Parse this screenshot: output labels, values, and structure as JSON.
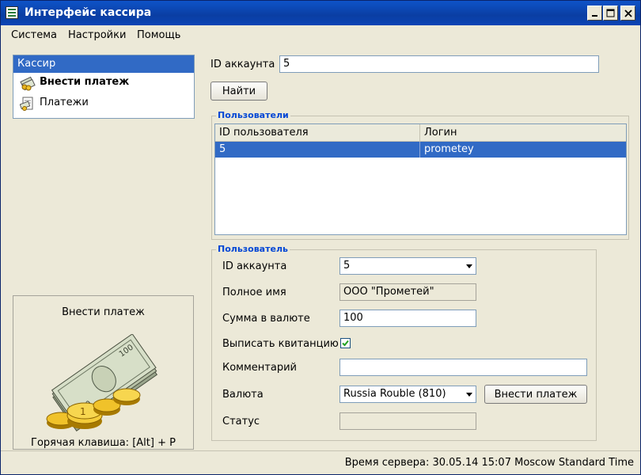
{
  "window": {
    "title": "Интерфейс кассира"
  },
  "menu": [
    "Система",
    "Настройки",
    "Помощь"
  ],
  "sidebar": {
    "header": "Кассир",
    "items": [
      {
        "label": "Внести платеж",
        "active": true,
        "icon": "payment-icon"
      },
      {
        "label": "Платежи",
        "active": false,
        "icon": "payments-list-icon"
      }
    ]
  },
  "hint": {
    "title": "Внести платеж",
    "hotkey": "Горячая клавиша: [Alt] + P"
  },
  "search": {
    "label": "ID аккаунта",
    "value": "5",
    "button": "Найти"
  },
  "users_group": {
    "title": "Пользователи",
    "columns": [
      "ID пользователя",
      "Логин"
    ],
    "rows": [
      {
        "id": "5",
        "login": "prometey",
        "selected": true
      }
    ]
  },
  "user_group": {
    "title": "Пользователь",
    "account_id_label": "ID аккаунта",
    "account_id_value": "5",
    "fullname_label": "Полное имя",
    "fullname_value": "ООО \"Прометей\"",
    "amount_label": "Сумма в валюте",
    "amount_value": "100",
    "receipt_label": "Выписать квитанцию",
    "receipt_checked": true,
    "comment_label": "Комментарий",
    "comment_value": "",
    "currency_label": "Валюта",
    "currency_value": "Russia Rouble (810)",
    "submit_button": "Внести платеж",
    "status_label": "Статус",
    "status_value": ""
  },
  "status": {
    "server_time": "Время сервера:   30.05.14 15:07 Moscow Standard Time"
  },
  "colors": {
    "selection": "#316ac5",
    "group_title": "#0046d5",
    "window_bg": "#ece9d8"
  }
}
